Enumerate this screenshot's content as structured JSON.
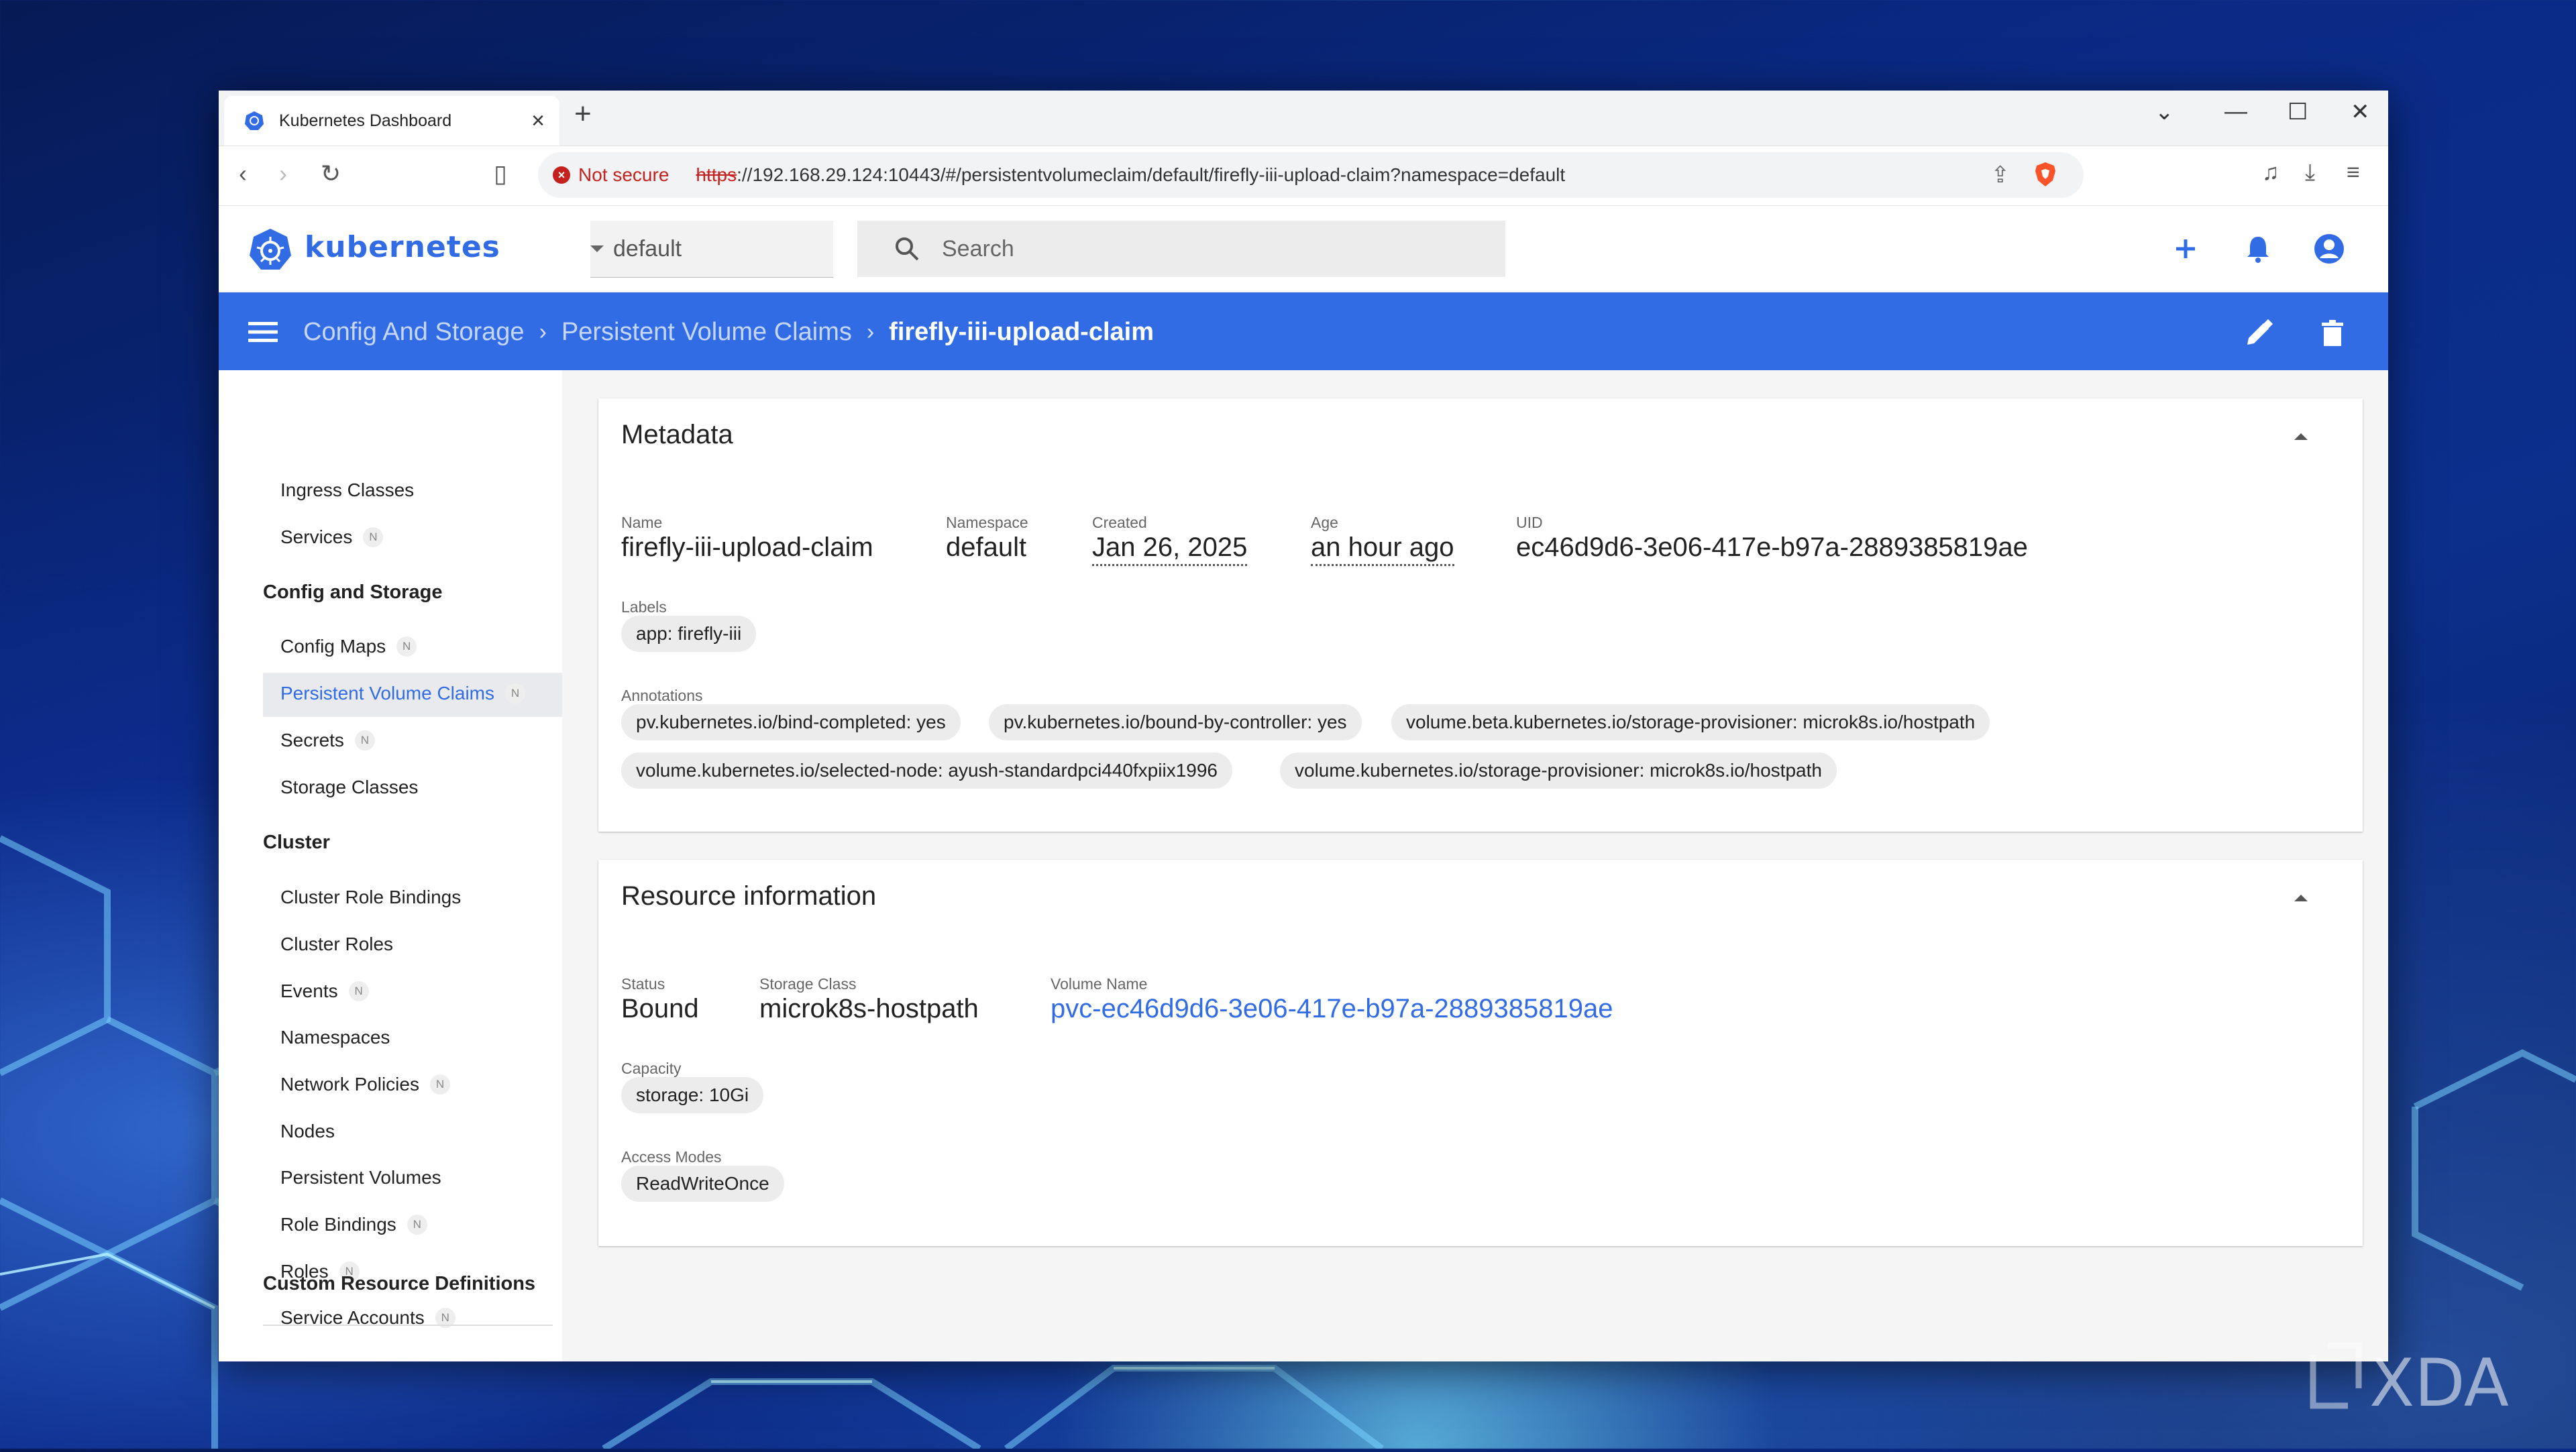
{
  "browser": {
    "tab_title": "Kubernetes Dashboard",
    "new_tab": "+",
    "security_label": "Not secure",
    "url_scheme": "https",
    "url_rest": "://192.168.29.124:10443/#/persistentvolumeclaim/default/firefly-iii-upload-claim?namespace=default"
  },
  "app": {
    "logo_text": "kubernetes",
    "namespace_selected": "default",
    "search_placeholder": "Search",
    "brand_color": "#326ce5"
  },
  "breadcrumbs": {
    "level1": "Config And Storage",
    "level2": "Persistent Volume Claims",
    "current": "firefly-iii-upload-claim"
  },
  "sidebar": {
    "items": [
      {
        "label": "Ingress Classes",
        "badge": ""
      },
      {
        "label": "Services",
        "badge": "N"
      }
    ],
    "config_section": "Config and Storage",
    "config_items": [
      {
        "label": "Config Maps",
        "badge": "N"
      },
      {
        "label": "Persistent Volume Claims",
        "badge": "N"
      },
      {
        "label": "Secrets",
        "badge": "N"
      },
      {
        "label": "Storage Classes",
        "badge": ""
      }
    ],
    "cluster_section": "Cluster",
    "cluster_items": [
      {
        "label": "Cluster Role Bindings",
        "badge": ""
      },
      {
        "label": "Cluster Roles",
        "badge": ""
      },
      {
        "label": "Events",
        "badge": "N"
      },
      {
        "label": "Namespaces",
        "badge": ""
      },
      {
        "label": "Network Policies",
        "badge": "N"
      },
      {
        "label": "Nodes",
        "badge": ""
      },
      {
        "label": "Persistent Volumes",
        "badge": ""
      },
      {
        "label": "Role Bindings",
        "badge": "N"
      },
      {
        "label": "Roles",
        "badge": "N"
      },
      {
        "label": "Service Accounts",
        "badge": "N"
      }
    ],
    "crd_section": "Custom Resource Definitions"
  },
  "metadata": {
    "title": "Metadata",
    "name_label": "Name",
    "name": "firefly-iii-upload-claim",
    "namespace_label": "Namespace",
    "namespace": "default",
    "created_label": "Created",
    "created": "Jan 26, 2025",
    "age_label": "Age",
    "age": "an hour ago",
    "uid_label": "UID",
    "uid": "ec46d9d6-3e06-417e-b97a-2889385819ae",
    "labels_label": "Labels",
    "labels": [
      "app: firefly-iii"
    ],
    "annotations_label": "Annotations",
    "annotations": [
      "pv.kubernetes.io/bind-completed: yes",
      "pv.kubernetes.io/bound-by-controller: yes",
      "volume.beta.kubernetes.io/storage-provisioner: microk8s.io/hostpath",
      "volume.kubernetes.io/selected-node: ayush-standardpci440fxpiix1996",
      "volume.kubernetes.io/storage-provisioner: microk8s.io/hostpath"
    ]
  },
  "resource": {
    "title": "Resource information",
    "status_label": "Status",
    "status": "Bound",
    "storage_class_label": "Storage Class",
    "storage_class": "microk8s-hostpath",
    "volume_name_label": "Volume Name",
    "volume_name": "pvc-ec46d9d6-3e06-417e-b97a-2889385819ae",
    "capacity_label": "Capacity",
    "capacity": "storage: 10Gi",
    "access_modes_label": "Access Modes",
    "access_modes": "ReadWriteOnce"
  },
  "watermark": "XDA"
}
